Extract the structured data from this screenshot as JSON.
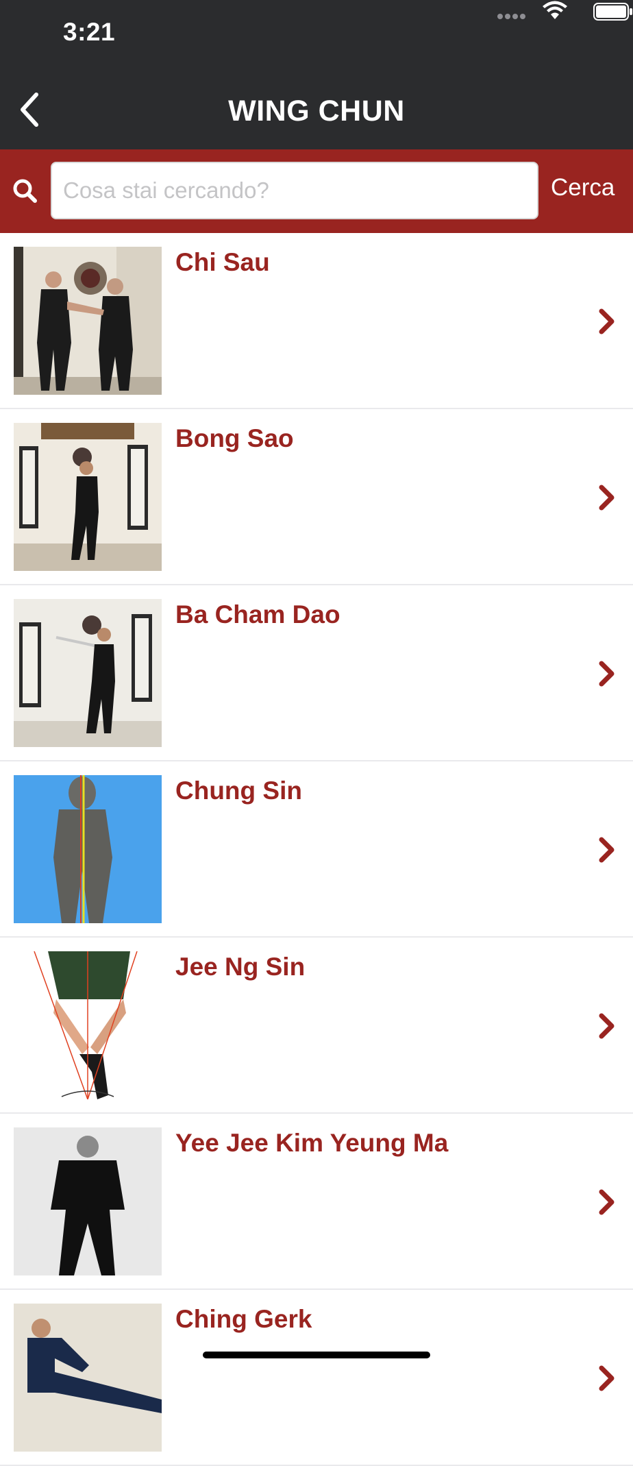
{
  "status_bar": {
    "time": "3:21"
  },
  "nav": {
    "title": "WING CHUN",
    "back_icon": "chevron-left-icon"
  },
  "search": {
    "placeholder": "Cosa stai cercando?",
    "value": "",
    "submit_label": "Cerca",
    "icon": "search-icon"
  },
  "items": [
    {
      "title": "Chi Sau",
      "image": "photo-two-practitioners"
    },
    {
      "title": "Bong Sao",
      "image": "photo-stance-banners"
    },
    {
      "title": "Ba Cham Dao",
      "image": "photo-knife-form"
    },
    {
      "title": "Chung Sin",
      "image": "diagram-centerline-figure"
    },
    {
      "title": "Jee Ng Sin",
      "image": "diagram-hands-lines"
    },
    {
      "title": "Yee Jee Kim Yeung Ma",
      "image": "photo-bw-stance"
    },
    {
      "title": "Ching Gerk",
      "image": "photo-kick"
    }
  ],
  "colors": {
    "header_bg": "#2b2c2e",
    "brand_red": "#992420",
    "divider": "#e9e9ec"
  }
}
